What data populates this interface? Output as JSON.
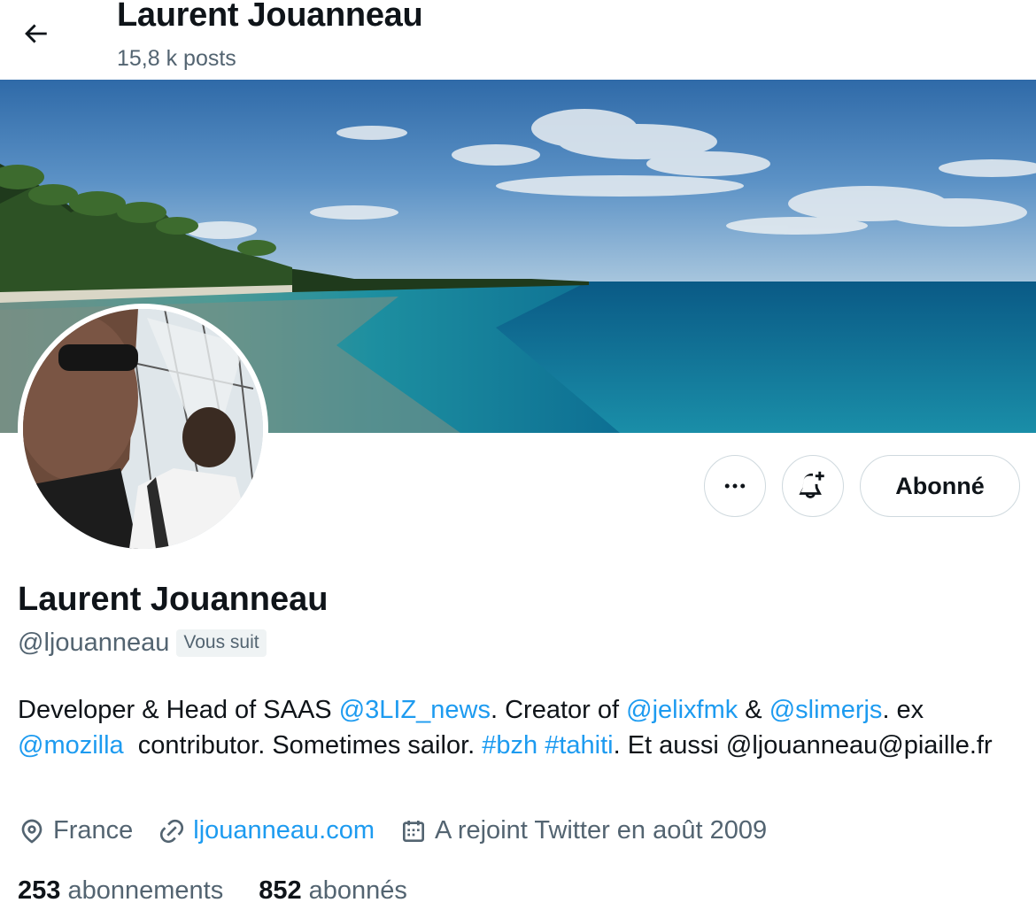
{
  "header": {
    "name": "Laurent Jouanneau",
    "posts": "15,8 k posts"
  },
  "actions": {
    "follow_label": "Abonné"
  },
  "profile": {
    "name": "Laurent Jouanneau",
    "handle": "@ljouanneau",
    "follows_you": "Vous suit",
    "bio": {
      "t1": "Developer & Head of SAAS ",
      "m1": "@3LIZ_news",
      "t2": ". Creator of ",
      "m2": "@jelixfmk",
      "t3": " & ",
      "m3": "@slimerjs",
      "t4": ". ex ",
      "m4": "@mozilla",
      "t5": "  contributor. Sometimes sailor. ",
      "h1": "#bzh",
      "t6": " ",
      "h2": "#tahiti",
      "t7": ". Et aussi @ljouanneau@piaille.fr"
    },
    "location": "France",
    "website": "ljouanneau.com",
    "joined": "A rejoint Twitter en août 2009",
    "following_count": "253",
    "following_label": "abonnements",
    "followers_count": "852",
    "followers_label": "abonnés"
  },
  "icons": {
    "back": "arrow-left-icon",
    "more": "more-dots-icon",
    "notify": "bell-plus-icon",
    "location": "location-pin-icon",
    "website": "link-icon",
    "joined": "calendar-icon"
  },
  "colors": {
    "accent": "#1d9bf0",
    "secondary_text": "#536471",
    "primary_text": "#0f1419",
    "border": "#cfd9de"
  }
}
